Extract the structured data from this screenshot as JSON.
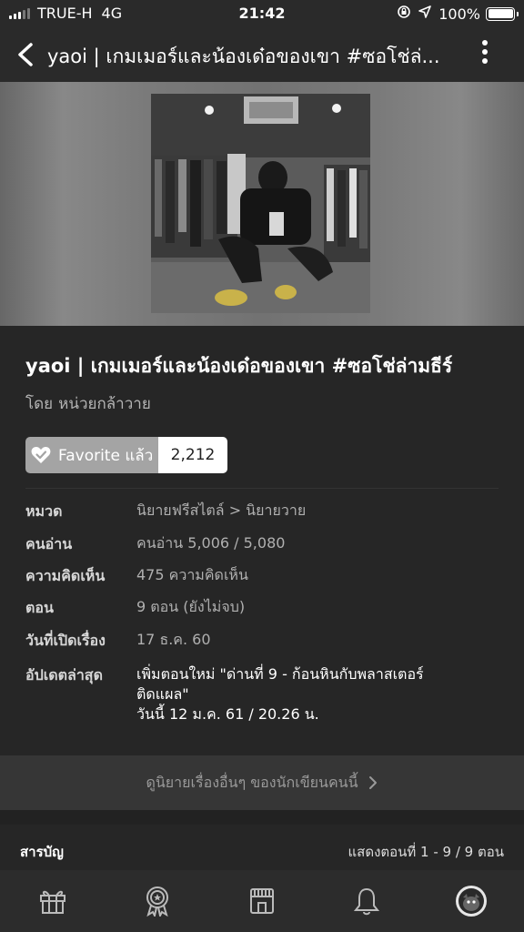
{
  "status_bar": {
    "carrier": "TRUE-H",
    "network": "4G",
    "time": "21:42",
    "battery": "100%",
    "signal_bars_active": 3,
    "signal_bars_total": 5,
    "battery_level": 1.0,
    "icons": [
      "rotation-lock-icon",
      "location-arrow-icon",
      "battery-icon"
    ]
  },
  "nav": {
    "title": "yaoi | เกมเมอร์และน้องเด๋อของเขา #ซอโช่ล่...",
    "back_icon": "chevron-left-icon",
    "more_icon": "more-vertical-icon"
  },
  "story": {
    "title": "yaoi | เกมเมอร์และน้องเด๋อของเขา #ซอโช่ล่ามธีร์",
    "author_label": "โดย",
    "author": "หน่วยกล้าวาย",
    "favorite_label": "Favorite แล้ว",
    "favorite_count": "2,212",
    "favorite_icon": "heart-check-icon"
  },
  "meta": [
    {
      "label": "หมวด",
      "value": [
        "นิยายฟรีสไตล์ > นิยายวาย"
      ]
    },
    {
      "label": "คนอ่าน",
      "value": [
        "คนอ่าน 5,006 / 5,080"
      ]
    },
    {
      "label": "ความคิดเห็น",
      "value": [
        "475 ความคิดเห็น"
      ]
    },
    {
      "label": "ตอน",
      "value": [
        "9 ตอน (ยังไม่จบ)"
      ]
    },
    {
      "label": "วันที่เปิดเรื่อง",
      "value": [
        "17 ธ.ค. 60"
      ]
    },
    {
      "label": "อัปเดตล่าสุด",
      "value": [
        "เพิ่มตอนใหม่ \"ด่านที่ 9 - ก้อนหินกับพลาสเตอร์",
        "ติดแผล\"",
        "วันนี้ 12 ม.ค. 61 / 20.26 น."
      ]
    }
  ],
  "more_stories": {
    "label": "ดูนิยายเรื่องอื่นๆ ของนักเขียนคนนี้",
    "icon": "chevron-right-icon"
  },
  "toc": {
    "title": "สารบัญ",
    "range": "แสดงตอนที่ 1 - 9 / 9 ตอน"
  },
  "tabbar": [
    "gift-icon",
    "award-icon",
    "store-icon",
    "bell-icon",
    "profile-avatar-icon"
  ],
  "colors": {
    "background": "#222222",
    "info_panel": "#262626",
    "favorite_button": "#a4a4a4",
    "more_stories_bar": "#363636",
    "tabbar": "#2c2c2c"
  }
}
